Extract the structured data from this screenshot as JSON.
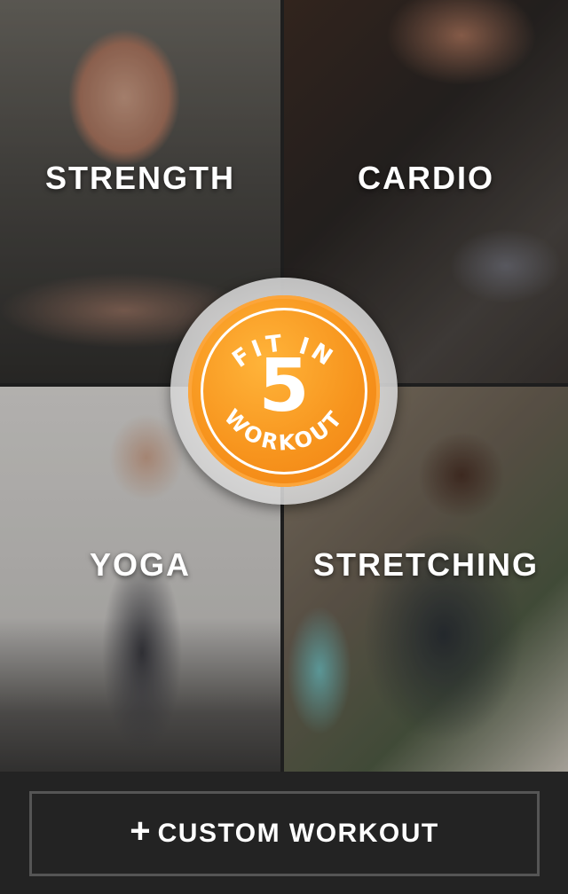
{
  "tiles": [
    {
      "id": "strength",
      "label": "STRENGTH"
    },
    {
      "id": "cardio",
      "label": "CARDIO"
    },
    {
      "id": "yoga",
      "label": "YOGA"
    },
    {
      "id": "stretching",
      "label": "STRETCHING"
    }
  ],
  "badge": {
    "top_text": "FIT IN",
    "number": "5",
    "bottom_text": "WORKOUT",
    "color": "#f7941d"
  },
  "custom_button": {
    "icon": "plus-icon",
    "plus": "+",
    "label": "CUSTOM WORKOUT"
  }
}
